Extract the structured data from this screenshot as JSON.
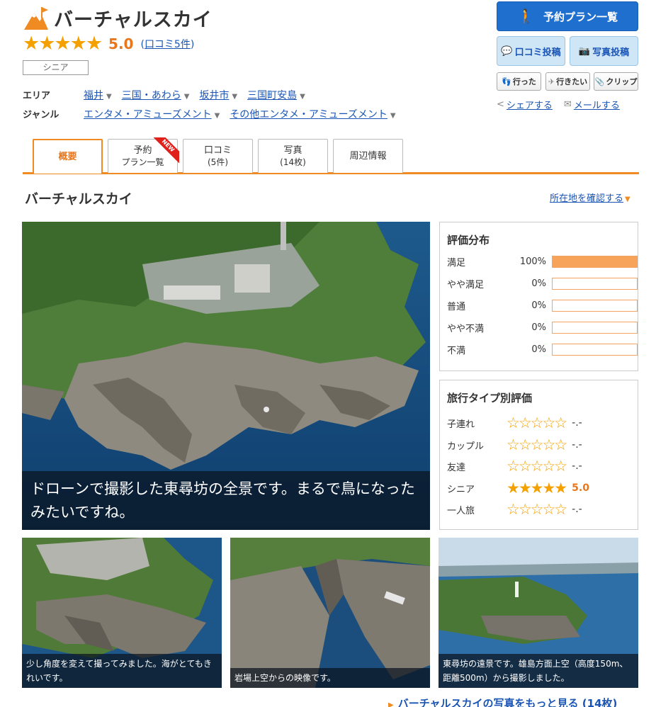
{
  "spot": {
    "title": "バーチャルスカイ",
    "rating_stars": "★★★★★",
    "rating_value": "5.0",
    "review_link": "口コミ5件",
    "tag": "シニア"
  },
  "meta": {
    "area_label": "エリア",
    "area_items": [
      "福井",
      "三国・あわら",
      "坂井市",
      "三国町安島"
    ],
    "genre_label": "ジャンル",
    "genre_items": [
      "エンタメ・アミューズメント",
      "その他エンタメ・アミューズメント"
    ]
  },
  "actions": {
    "plan_button": "予約プラン一覧",
    "review_button": "口コミ投稿",
    "photo_button": "写真投稿",
    "went": "行った",
    "want": "行きたい",
    "clip": "クリップ",
    "share": "シェアする",
    "mail": "メールする"
  },
  "tabs": [
    {
      "label": "概要",
      "sub": ""
    },
    {
      "label": "予約",
      "sub": "プラン一覧",
      "badge": "NEW"
    },
    {
      "label": "口コミ",
      "sub": "(5件)"
    },
    {
      "label": "写真",
      "sub": "(14枚)"
    },
    {
      "label": "周辺情報",
      "sub": ""
    }
  ],
  "section": {
    "title": "バーチャルスカイ",
    "map_link": "所在地を確認する"
  },
  "main_photo": {
    "caption": "ドローンで撮影した東尋坊の全景です。まるで鳥になったみたいですね。"
  },
  "rating_distribution": {
    "title": "評価分布",
    "rows": [
      {
        "label": "満足",
        "percent": "100%",
        "fill": 1.0
      },
      {
        "label": "やや満足",
        "percent": "0%",
        "fill": 0
      },
      {
        "label": "普通",
        "percent": "0%",
        "fill": 0
      },
      {
        "label": "やや不満",
        "percent": "0%",
        "fill": 0
      },
      {
        "label": "不満",
        "percent": "0%",
        "fill": 0
      }
    ]
  },
  "travel_type": {
    "title": "旅行タイプ別評価",
    "rows": [
      {
        "label": "子連れ",
        "stars": "☆☆☆☆☆",
        "score": "-.-"
      },
      {
        "label": "カップル",
        "stars": "☆☆☆☆☆",
        "score": "-.-"
      },
      {
        "label": "友達",
        "stars": "☆☆☆☆☆",
        "score": "-.-"
      },
      {
        "label": "シニア",
        "stars": "★★★★★",
        "score": "5.0"
      },
      {
        "label": "一人旅",
        "stars": "☆☆☆☆☆",
        "score": "-.-"
      }
    ]
  },
  "thumbnails": [
    {
      "caption": "少し角度を変えて撮ってみました。海がとてもきれいです。"
    },
    {
      "caption": "岩場上空からの映像です。"
    },
    {
      "caption": "東尋坊の遠景です。雄島方面上空（高度150m、距離500m）から撮影しました。"
    }
  ],
  "more_photos_link": "バーチャルスカイの写真をもっと見る (14枚)",
  "colors": {
    "accent_orange": "#f08a23",
    "link_blue": "#1a55b5",
    "plan_button_blue": "#1f6fcf",
    "star_gold": "#f4a100"
  }
}
